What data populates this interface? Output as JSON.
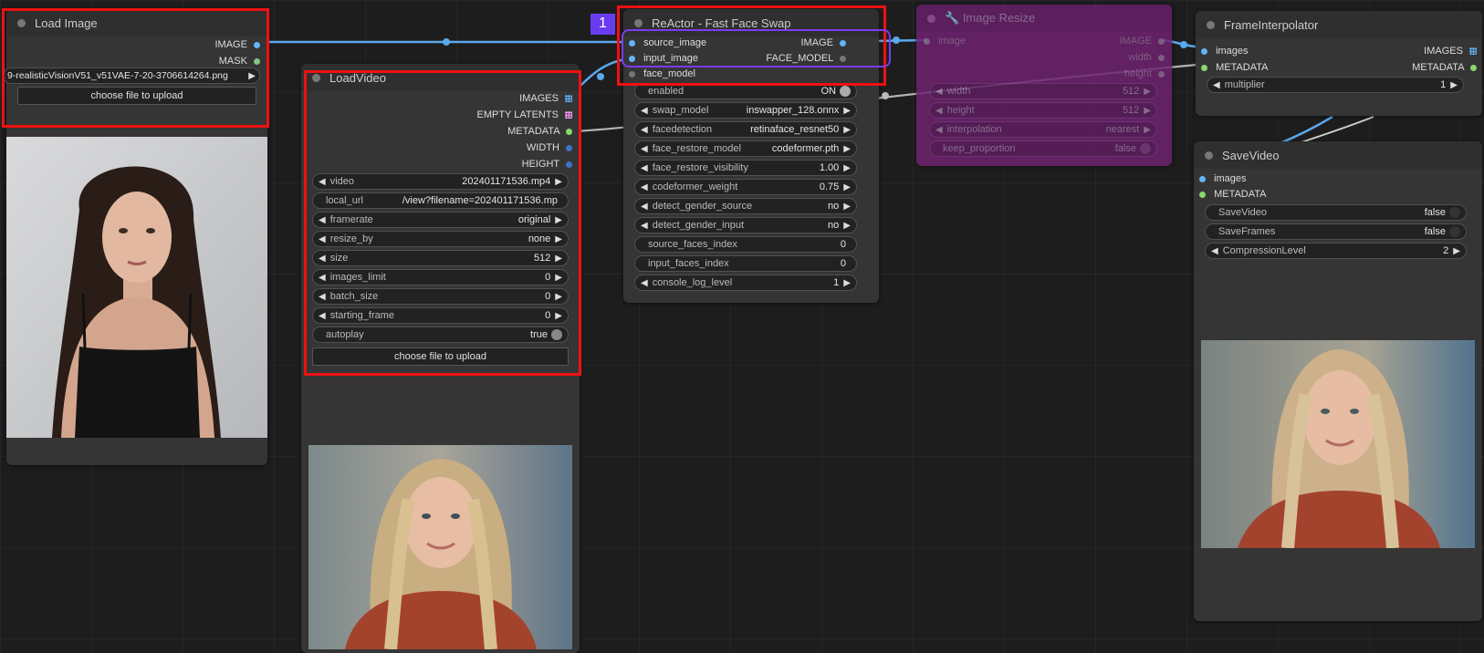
{
  "load_image": {
    "title": "Load Image",
    "outputs": [
      "IMAGE",
      "MASK"
    ],
    "image_file": "9-realisticVisionV51_v51VAE-7-20-3706614264.png",
    "upload_label": "choose file to upload"
  },
  "load_video": {
    "title": "LoadVideo",
    "outputs": [
      "IMAGES",
      "EMPTY LATENTS",
      "METADATA",
      "WIDTH",
      "HEIGHT"
    ],
    "widgets": [
      {
        "label": "video",
        "value": "202401171536.mp4"
      },
      {
        "label": "local_url",
        "value": "/view?filename=202401171536.mp"
      },
      {
        "label": "framerate",
        "value": "original"
      },
      {
        "label": "resize_by",
        "value": "none"
      },
      {
        "label": "size",
        "value": "512"
      },
      {
        "label": "images_limit",
        "value": "0"
      },
      {
        "label": "batch_size",
        "value": "0"
      },
      {
        "label": "starting_frame",
        "value": "0"
      },
      {
        "label": "autoplay",
        "value": "true"
      }
    ],
    "upload_label": "choose file to upload"
  },
  "reactor": {
    "badge": "1",
    "title": "ReActor - Fast Face Swap",
    "inputs": [
      "source_image",
      "input_image",
      "face_model"
    ],
    "outputs": [
      "IMAGE",
      "FACE_MODEL"
    ],
    "widgets": [
      {
        "label": "enabled",
        "value": "ON"
      },
      {
        "label": "swap_model",
        "value": "inswapper_128.onnx"
      },
      {
        "label": "facedetection",
        "value": "retinaface_resnet50"
      },
      {
        "label": "face_restore_model",
        "value": "codeformer.pth"
      },
      {
        "label": "face_restore_visibility",
        "value": "1.00"
      },
      {
        "label": "codeformer_weight",
        "value": "0.75"
      },
      {
        "label": "detect_gender_source",
        "value": "no"
      },
      {
        "label": "detect_gender_input",
        "value": "no"
      },
      {
        "label": "source_faces_index",
        "value": "0"
      },
      {
        "label": "input_faces_index",
        "value": "0"
      },
      {
        "label": "console_log_level",
        "value": "1"
      }
    ]
  },
  "image_resize": {
    "title": "Image Resize",
    "input": "image",
    "outputs": [
      "IMAGE",
      "width",
      "height"
    ],
    "widgets": [
      {
        "label": "width",
        "value": "512"
      },
      {
        "label": "height",
        "value": "512"
      },
      {
        "label": "interpolation",
        "value": "nearest"
      },
      {
        "label": "keep_proportion",
        "value": "false"
      }
    ]
  },
  "frame_interpolator": {
    "title": "FrameInterpolator",
    "inputs": [
      "images",
      "METADATA"
    ],
    "outputs": [
      "IMAGES",
      "METADATA"
    ],
    "widgets": [
      {
        "label": "multiplier",
        "value": "1"
      }
    ]
  },
  "save_video": {
    "title": "SaveVideo",
    "inputs": [
      "images",
      "METADATA"
    ],
    "widgets": [
      {
        "label": "SaveVideo",
        "value": "false"
      },
      {
        "label": "SaveFrames",
        "value": "false"
      },
      {
        "label": "CompressionLevel",
        "value": "2"
      }
    ]
  },
  "colors": {
    "image_pin": "#64b5f6",
    "mask_pin": "#81c784",
    "metadata_pin": "#8bd86b",
    "latent_pin": "#ff9cf9",
    "int_pin": "#3f73c6",
    "highlight_red": "#ee1111",
    "highlight_purple": "#7b3cf0",
    "bypassed_node": "#7a1f7a"
  }
}
